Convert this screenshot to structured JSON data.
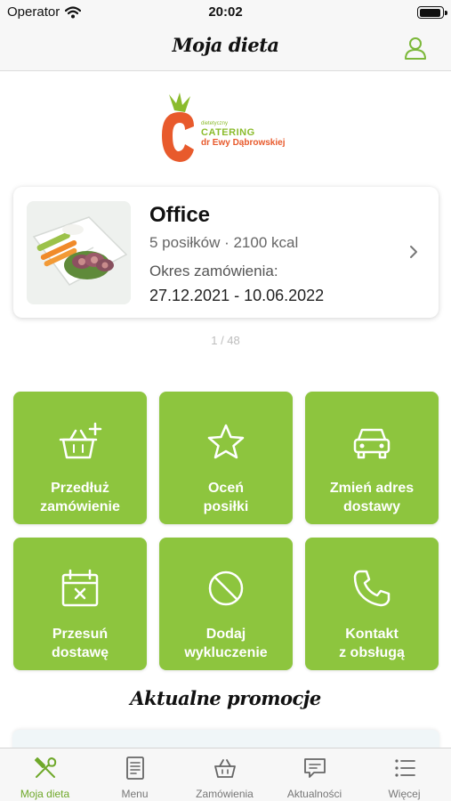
{
  "status_bar": {
    "carrier": "Operator",
    "time": "20:02"
  },
  "nav": {
    "title": "Moja dieta"
  },
  "logo": {
    "line1": "dietetyczny",
    "line2": "CATERING",
    "line3": "dr Ewy Dąbrowskiej"
  },
  "order": {
    "name": "Office",
    "meals": "5 posiłków · 2100 kcal",
    "period_label": "Okres zamówienia:",
    "dates": "27.12.2021 - 10.06.2022"
  },
  "pager": "1 / 48",
  "tiles": [
    {
      "label": "Przedłuż\nzamówienie",
      "icon": "basket-plus-icon"
    },
    {
      "label": "Oceń\nposiłki",
      "icon": "star-icon"
    },
    {
      "label": "Zmień adres\ndostawy",
      "icon": "car-icon"
    },
    {
      "label": "Przesuń\ndostawę",
      "icon": "calendar-x-icon"
    },
    {
      "label": "Dodaj\nwykluczenie",
      "icon": "prohibited-icon"
    },
    {
      "label": "Kontakt\nz obsługą",
      "icon": "phone-icon"
    }
  ],
  "promotions": {
    "title": "Aktualne promocje"
  },
  "tabs": [
    {
      "label": "Moja dieta",
      "icon": "fork-knife-icon",
      "active": true
    },
    {
      "label": "Menu",
      "icon": "menu-document-icon",
      "active": false
    },
    {
      "label": "Zamówienia",
      "icon": "basket-icon",
      "active": false
    },
    {
      "label": "Aktualności",
      "icon": "chat-bubble-icon",
      "active": false
    },
    {
      "label": "Więcej",
      "icon": "list-icon",
      "active": false
    }
  ],
  "colors": {
    "accent": "#8dc53e",
    "accent_dark": "#6fa82a",
    "logo_orange": "#e85a2c"
  }
}
